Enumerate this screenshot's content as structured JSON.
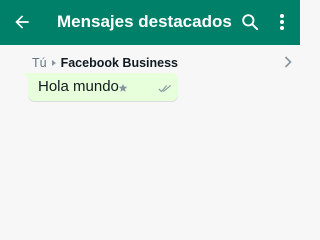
{
  "appbar": {
    "title": "Mensajes destacados",
    "back_icon": "arrow-back-icon",
    "search_icon": "search-icon",
    "menu_icon": "more-vertical-icon",
    "color": "#008069"
  },
  "message": {
    "sender": "Tú",
    "recipient": "Facebook Business",
    "text": "Hola mundo",
    "starred_icon": "star-icon",
    "status_icon": "double-check-icon",
    "bubble_color": "#e7ffdb"
  }
}
